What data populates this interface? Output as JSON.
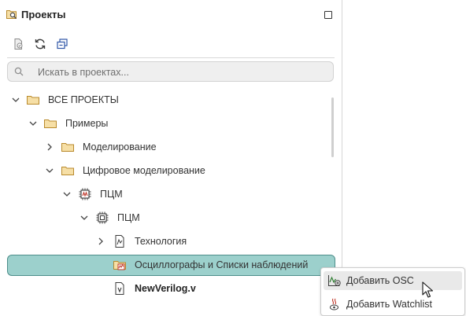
{
  "panel": {
    "title": "Проекты",
    "title_icon": "project-search-icon",
    "maximize_icon": "maximize-icon"
  },
  "toolbar": {
    "buttons": [
      "new-file-icon",
      "refresh-icon",
      "collapse-all-icon"
    ]
  },
  "search": {
    "placeholder": "Искать в проектах...",
    "value": ""
  },
  "tree": [
    {
      "label": "ВСЕ ПРОЕКТЫ",
      "icon": "folder-icon",
      "expanded": true
    },
    {
      "label": "Примеры",
      "icon": "folder-icon",
      "expanded": true
    },
    {
      "label": "Моделирование",
      "icon": "folder-icon",
      "expanded": false
    },
    {
      "label": "Цифровое моделирование",
      "icon": "folder-icon",
      "expanded": true
    },
    {
      "label": "ПЦМ",
      "icon": "chip-project-icon",
      "expanded": true
    },
    {
      "label": "ПЦМ",
      "icon": "chip-icon",
      "expanded": true
    },
    {
      "label": "Технология",
      "icon": "technology-file-icon",
      "expanded": false
    },
    {
      "label": "Осциллографы и Списки наблюдений",
      "icon": "oscilloscope-folder-icon",
      "selected": true
    },
    {
      "label": "NewVerilog.v",
      "icon": "verilog-file-icon"
    }
  ],
  "context_menu": {
    "items": [
      {
        "label": "Добавить OSC",
        "icon": "add-osc-icon"
      },
      {
        "label": "Добавить Watchlist",
        "icon": "add-watchlist-icon"
      }
    ]
  },
  "colors": {
    "selection": "#9cd0cc",
    "selection_border": "#4e8f8b",
    "folder": "#d8a94a",
    "chip_accent": "#c0392b"
  }
}
